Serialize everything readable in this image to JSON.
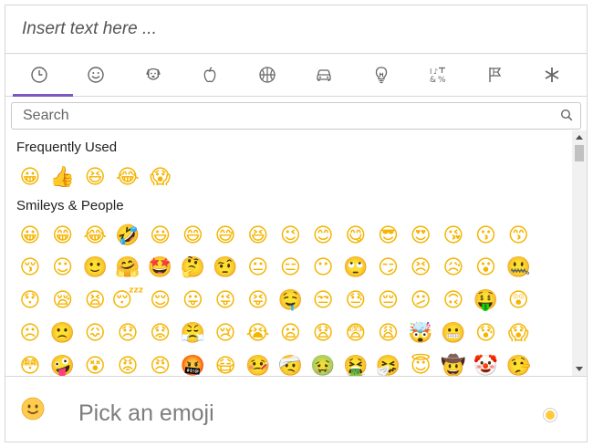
{
  "text_input": {
    "placeholder": "Insert text here ..."
  },
  "tabs": [
    {
      "icon": "clock-icon",
      "active": true
    },
    {
      "icon": "smiley-icon"
    },
    {
      "icon": "dog-face-icon"
    },
    {
      "icon": "apple-icon"
    },
    {
      "icon": "basketball-icon"
    },
    {
      "icon": "car-icon"
    },
    {
      "icon": "lightbulb-icon"
    },
    {
      "icon": "symbols-icon"
    },
    {
      "icon": "flag-icon"
    },
    {
      "icon": "asterisk-icon"
    }
  ],
  "search": {
    "placeholder": "Search"
  },
  "sections": [
    {
      "title": "Frequently Used",
      "rows": [
        [
          "😀",
          "👍",
          "😆",
          "😂",
          "😱"
        ]
      ]
    },
    {
      "title": "Smileys & People",
      "rows": [
        [
          "😀",
          "😁",
          "😂",
          "🤣",
          "😃",
          "😄",
          "😅",
          "😆",
          "😉",
          "😊",
          "😋",
          "😎",
          "😍",
          "😘",
          "😗",
          "😙"
        ],
        [
          "😚",
          "☺",
          "🙂",
          "🤗",
          "🤩",
          "🤔",
          "🤨",
          "😐",
          "😑",
          "😶",
          "🙄",
          "😏",
          "😣",
          "😥",
          "😮",
          "🤐"
        ],
        [
          "😯",
          "😪",
          "😫",
          "😴",
          "😌",
          "😛",
          "😜",
          "😝",
          "🤤",
          "😒",
          "😓",
          "😔",
          "😕",
          "🙃",
          "🤑",
          "😲"
        ],
        [
          "☹",
          "🙁",
          "😖",
          "😞",
          "😟",
          "😤",
          "😢",
          "😭",
          "😦",
          "😧",
          "😨",
          "😩",
          "🤯",
          "😬",
          "😰",
          "😱"
        ],
        [
          "😳",
          "🤪",
          "😵",
          "😡",
          "😠",
          "🤬",
          "😷",
          "🤒",
          "🤕",
          "🤢",
          "🤮",
          "🤧",
          "😇",
          "🤠",
          "🤡",
          "🤥"
        ]
      ]
    }
  ],
  "footer": {
    "preview_emoji": "🙂",
    "preview_text": "Pick an emoji",
    "skin_tone_color": "#ffc93a"
  },
  "colors": {
    "accent": "#7e57c2",
    "emoji": "#f4b400"
  }
}
